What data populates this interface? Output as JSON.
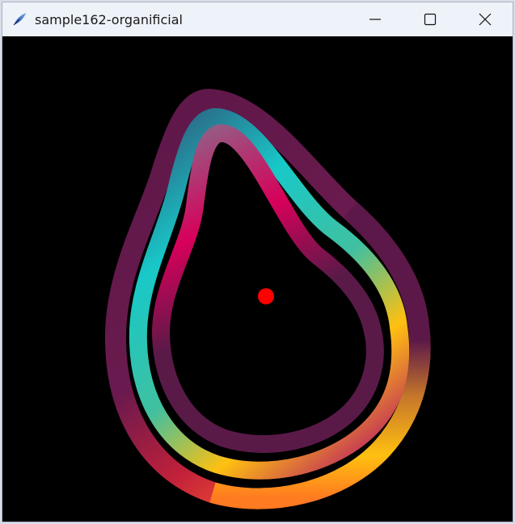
{
  "window": {
    "title": "sample162-organificial",
    "app_icon": "feather-quill-icon",
    "controls": [
      "minimize-icon",
      "maximize-icon",
      "close-icon"
    ]
  },
  "sketch": {
    "background_color": "#000000",
    "center_dot_color": "#ff0000",
    "ring_colors": [
      "#5c1848",
      "#18c8c8",
      "#d8005a",
      "#ffc010",
      "#ff5a30",
      "#6a1a4e"
    ]
  }
}
